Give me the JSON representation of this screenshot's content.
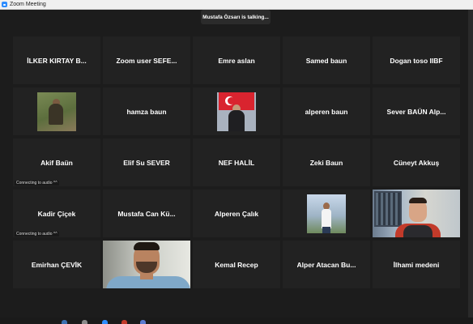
{
  "window": {
    "title": "Zoom Meeting"
  },
  "speaker_banner": "Mustafa Özsarı is talking...",
  "participants": [
    {
      "name": "İLKER KIRTAY B...",
      "kind": "name",
      "status": ""
    },
    {
      "name": "Zoom user SEFE...",
      "kind": "name",
      "status": ""
    },
    {
      "name": "Emre aslan",
      "kind": "name",
      "status": ""
    },
    {
      "name": "Samed baun",
      "kind": "name",
      "status": ""
    },
    {
      "name": "Dogan toso IIBF",
      "kind": "name",
      "status": ""
    },
    {
      "name": "",
      "kind": "avatar-soldier",
      "status": ""
    },
    {
      "name": "hamza baun",
      "kind": "name",
      "status": ""
    },
    {
      "name": "",
      "kind": "avatar-flag",
      "status": ""
    },
    {
      "name": "alperen baun",
      "kind": "name",
      "status": ""
    },
    {
      "name": "Sever BAÜN Alp...",
      "kind": "name",
      "status": ""
    },
    {
      "name": "Akif Baün",
      "kind": "name",
      "status": "Connecting to audio ^^"
    },
    {
      "name": "Elif Su SEVER",
      "kind": "name",
      "status": ""
    },
    {
      "name": "NEF HALİL",
      "kind": "name",
      "status": ""
    },
    {
      "name": "Zeki  Baun",
      "kind": "name",
      "status": ""
    },
    {
      "name": "Cüneyt Akkuş",
      "kind": "name",
      "status": ""
    },
    {
      "name": "Kadir Çiçek",
      "kind": "name",
      "status": "Connecting to audio ^^"
    },
    {
      "name": "Mustafa  Can  Kü...",
      "kind": "name",
      "status": ""
    },
    {
      "name": "Alperen Çalık",
      "kind": "name",
      "status": ""
    },
    {
      "name": "",
      "kind": "avatar-sky",
      "status": ""
    },
    {
      "name": "",
      "kind": "video-ilhami",
      "status": ""
    },
    {
      "name": "Emirhan ÇEVİK",
      "kind": "name",
      "status": ""
    },
    {
      "name": "",
      "kind": "video-cam",
      "status": ""
    },
    {
      "name": "Kemal Recep",
      "kind": "name",
      "status": ""
    },
    {
      "name": "Alper Atacan Bu...",
      "kind": "name",
      "status": ""
    },
    {
      "name": "İlhami medeni",
      "kind": "name",
      "status": ""
    }
  ],
  "icons": {
    "app": "zoom-app-icon"
  },
  "colors": {
    "background": "#1c1c1c",
    "tile": "#222222",
    "accent": "#2d8cff"
  }
}
